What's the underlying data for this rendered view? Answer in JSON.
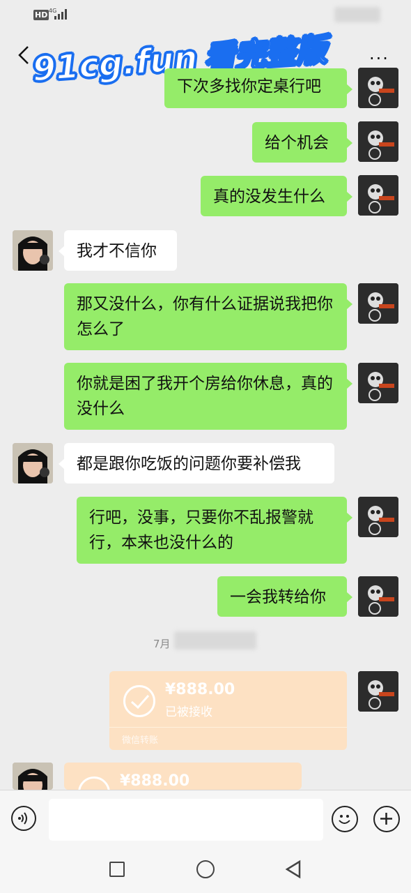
{
  "status": {
    "hd": "HD",
    "net": "4G"
  },
  "header": {
    "watermark_domain": "91cg.fun",
    "watermark_text": "看完整版",
    "more": "···"
  },
  "messages": [
    {
      "from": "me",
      "text": "下次多找你定桌行吧"
    },
    {
      "from": "me",
      "text": "给个机会"
    },
    {
      "from": "me",
      "text": "真的没发生什么"
    },
    {
      "from": "them",
      "text": "我才不信你"
    },
    {
      "from": "me",
      "text": "那又没什么，你有什么证据说我把你怎么了"
    },
    {
      "from": "me",
      "text": "你就是困了我开个房给你休息，真的没什么"
    },
    {
      "from": "them",
      "text": "都是跟你吃饭的问题你要补偿我"
    },
    {
      "from": "me",
      "text": "行吧，没事，只要你不乱报警就行，本来也没什么的"
    },
    {
      "from": "me",
      "text": "一会我转给你"
    }
  ],
  "timestamp": "7月",
  "transfers": [
    {
      "from": "me",
      "amount": "¥888.00",
      "status": "已被接收",
      "footer": "微信转账"
    },
    {
      "from": "them",
      "amount": "¥888.00"
    }
  ],
  "colors": {
    "my_bubble": "#95ec69",
    "their_bubble": "#ffffff",
    "transfer": "#fde1c3",
    "background": "#ededed"
  }
}
